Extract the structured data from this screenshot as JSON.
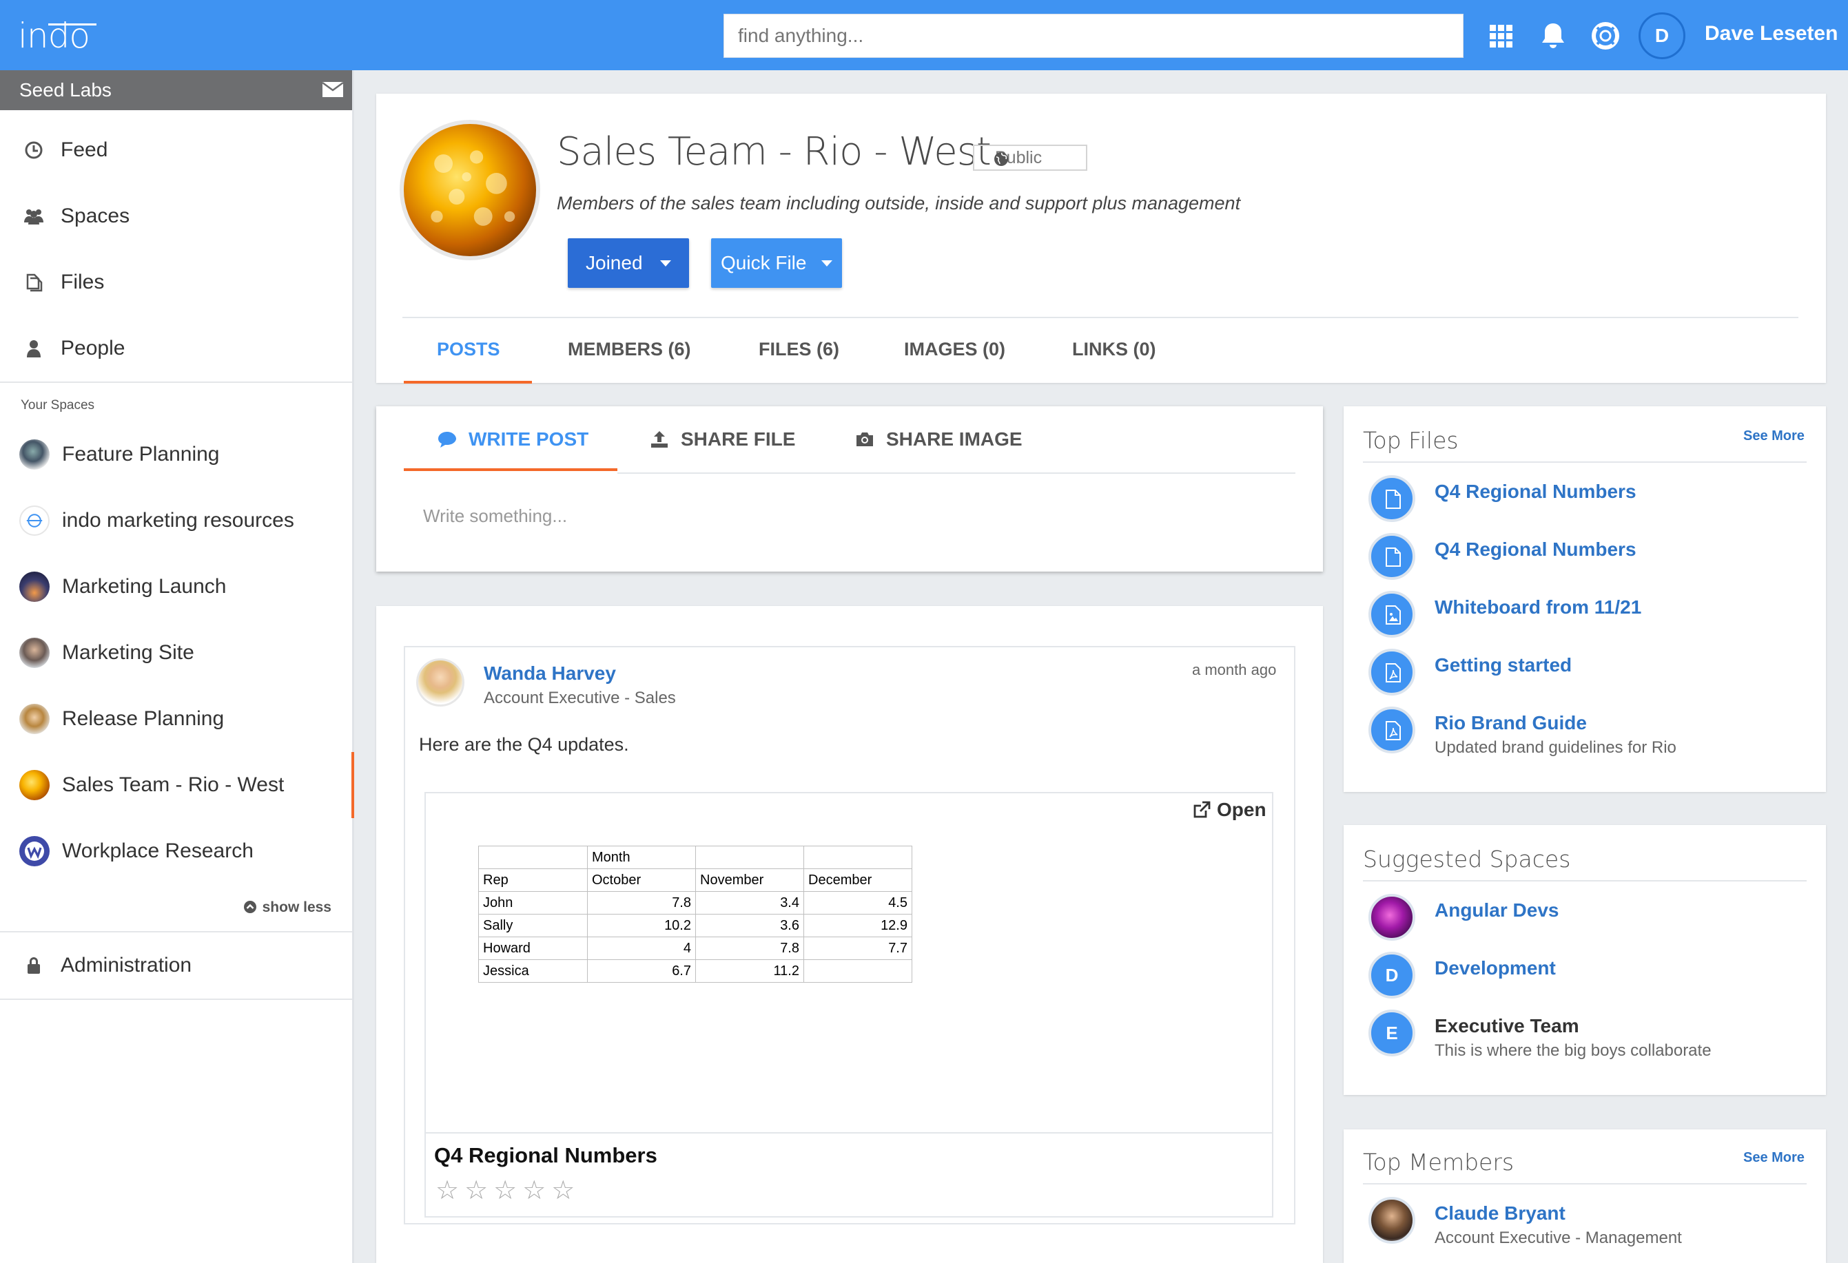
{
  "topbar": {
    "logo": "indo",
    "search_placeholder": "find anything...",
    "avatar_initial": "D",
    "username": "Dave Leseten"
  },
  "sidebar": {
    "org_name": "Seed Labs",
    "nav": [
      {
        "label": "Feed",
        "icon": "clock-icon"
      },
      {
        "label": "Spaces",
        "icon": "people-group-icon"
      },
      {
        "label": "Files",
        "icon": "files-icon"
      },
      {
        "label": "People",
        "icon": "person-icon"
      }
    ],
    "your_spaces_label": "Your Spaces",
    "spaces": [
      {
        "label": "Feature Planning"
      },
      {
        "label": "indo marketing resources"
      },
      {
        "label": "Marketing Launch"
      },
      {
        "label": "Marketing Site"
      },
      {
        "label": "Release Planning"
      },
      {
        "label": "Sales Team - Rio - West",
        "active": true
      },
      {
        "label": "Workplace Research"
      }
    ],
    "show_less": "show less",
    "admin_label": "Administration"
  },
  "space": {
    "title": "Sales Team - Rio - West",
    "visibility": "Public",
    "description": "Members of the sales team including outside, inside and support plus management",
    "joined_label": "Joined",
    "quick_file_label": "Quick File",
    "tabs": [
      "POSTS",
      "MEMBERS (6)",
      "FILES (6)",
      "IMAGES (0)",
      "LINKS (0)"
    ],
    "active_tab": "POSTS"
  },
  "composer": {
    "tabs": [
      "WRITE POST",
      "SHARE FILE",
      "SHARE IMAGE"
    ],
    "placeholder": "Write something..."
  },
  "post": {
    "author": "Wanda Harvey",
    "role": "Account Executive - Sales",
    "time": "a month ago",
    "text": "Here are the Q4 updates.",
    "open_label": "Open",
    "file_name": "Q4 Regional Numbers",
    "rating": 0,
    "stars": "☆☆☆☆☆",
    "sheet": {
      "header_group": "Month",
      "columns": [
        "Rep",
        "October",
        "November",
        "December"
      ],
      "rows": [
        [
          "John",
          "7.8",
          "3.4",
          "4.5"
        ],
        [
          "Sally",
          "10.2",
          "3.6",
          "12.9"
        ],
        [
          "Howard",
          "4",
          "7.8",
          "7.7"
        ],
        [
          "Jessica",
          "6.7",
          "11.2",
          ""
        ]
      ]
    }
  },
  "top_files": {
    "title": "Top Files",
    "see_more": "See More",
    "items": [
      {
        "name": "Q4 Regional Numbers",
        "icon": "document-icon"
      },
      {
        "name": "Q4 Regional Numbers",
        "icon": "document-icon"
      },
      {
        "name": "Whiteboard from 11/21",
        "icon": "image-file-icon"
      },
      {
        "name": "Getting started",
        "icon": "pdf-file-icon"
      },
      {
        "name": "Rio Brand Guide",
        "sub": "Updated brand guidelines for Rio",
        "icon": "pdf-file-icon"
      }
    ]
  },
  "suggested_spaces": {
    "title": "Suggested Spaces",
    "items": [
      {
        "name": "Angular Devs"
      },
      {
        "name": "Development",
        "initial": "D"
      },
      {
        "name": "Executive Team",
        "initial": "E",
        "sub": "This is where the big boys collaborate"
      }
    ]
  },
  "top_members": {
    "title": "Top Members",
    "see_more": "See More",
    "items": [
      {
        "name": "Claude Bryant",
        "role": "Account Executive - Management"
      }
    ]
  },
  "colors": {
    "brand_blue": "#3f93f2",
    "accent_orange": "#f4692a",
    "link_blue": "#2e74c6",
    "joined_button": "#2b6dd6",
    "sidebar_org_bar": "#6d6e70"
  }
}
